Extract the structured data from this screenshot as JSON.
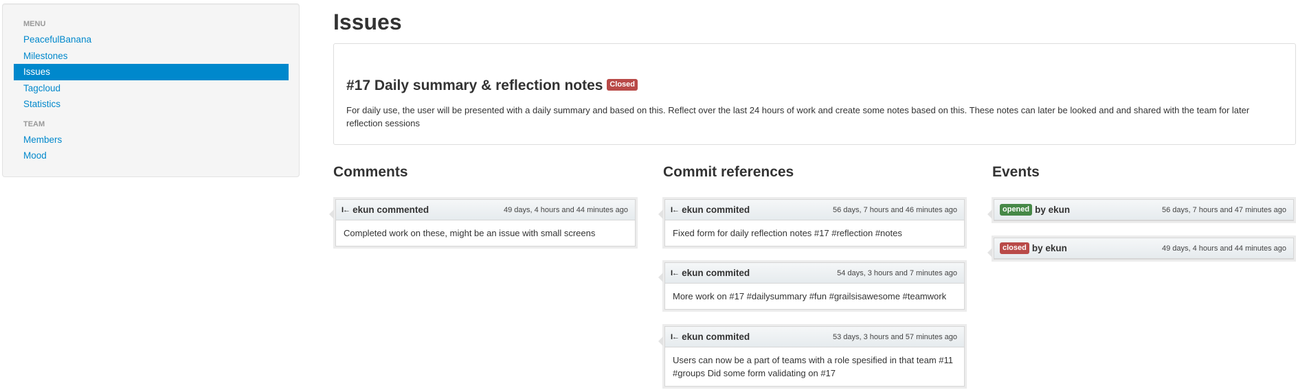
{
  "sidebar": {
    "menu_header": "MENU",
    "menu_items": [
      {
        "label": "PeacefulBanana",
        "active": false
      },
      {
        "label": "Milestones",
        "active": false
      },
      {
        "label": "Issues",
        "active": true
      },
      {
        "label": "Tagcloud",
        "active": false
      },
      {
        "label": "Statistics",
        "active": false
      }
    ],
    "team_header": "TEAM",
    "team_items": [
      {
        "label": "Members"
      },
      {
        "label": "Mood"
      }
    ]
  },
  "page": {
    "title": "Issues"
  },
  "issue": {
    "title": "#17 Daily summary & reflection notes",
    "status": "Closed",
    "description": "For daily use, the user will be presented with a daily summary and based on this. Reflect over the last 24 hours of work and create some notes based on this. These notes can later be looked and and shared with the team for later reflection sessions"
  },
  "comments": {
    "title": "Comments",
    "items": [
      {
        "author": "ekun commented",
        "time": "49 days, 4 hours and 44 minutes ago",
        "body": "Completed work on these, might be an issue with small screens"
      }
    ]
  },
  "commits": {
    "title": "Commit references",
    "items": [
      {
        "author": "ekun commited",
        "time": "56 days, 7 hours and 46 minutes ago",
        "body": "Fixed form for daily reflection notes #17 #reflection #notes"
      },
      {
        "author": "ekun commited",
        "time": "54 days, 3 hours and 7 minutes ago",
        "body": "More work on #17 #dailysummary #fun #grailsisawesome #teamwork"
      },
      {
        "author": "ekun commited",
        "time": "53 days, 3 hours and 57 minutes ago",
        "body": "Users can now be a part of teams with a role spesified in that team #11 #groups Did some form validating on #17"
      }
    ]
  },
  "events": {
    "title": "Events",
    "items": [
      {
        "badge": "opened",
        "text": "by ekun",
        "time": "56 days, 7 hours and 47 minutes ago"
      },
      {
        "badge": "closed",
        "text": "by ekun",
        "time": "49 days, 4 hours and 44 minutes ago"
      }
    ]
  },
  "icons": {
    "history": "I←",
    "history_icon_name": "history-icon"
  },
  "colors": {
    "link": "#0088cc",
    "active_bg": "#0088cc",
    "closed_badge": "#b94a48",
    "opened_badge": "#468847"
  }
}
